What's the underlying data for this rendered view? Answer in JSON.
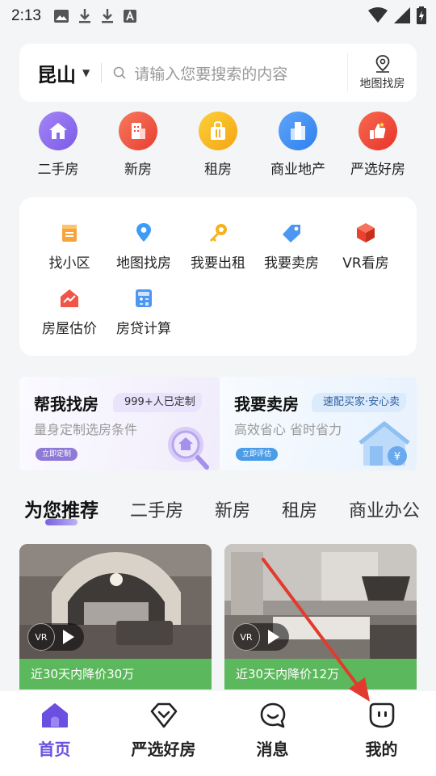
{
  "status_bar": {
    "time": "2:13"
  },
  "search": {
    "city": "昆山",
    "placeholder": "请输入您要搜索的内容",
    "map_label": "地图找房"
  },
  "categories": [
    {
      "label": "二手房",
      "icon": "home-icon",
      "color": "#8f6ff0"
    },
    {
      "label": "新房",
      "icon": "building-icon",
      "color": "#ef5542"
    },
    {
      "label": "租房",
      "icon": "bag-icon",
      "color": "#f8b51c"
    },
    {
      "label": "商业地产",
      "icon": "office-icon",
      "color": "#3b8ef3"
    },
    {
      "label": "严选好房",
      "icon": "thumbs-up-icon",
      "color": "#f0453a"
    }
  ],
  "tools": [
    {
      "label": "找小区",
      "icon": "community-icon"
    },
    {
      "label": "地图找房",
      "icon": "location-pin-icon"
    },
    {
      "label": "我要出租",
      "icon": "key-icon"
    },
    {
      "label": "我要卖房",
      "icon": "tag-icon"
    },
    {
      "label": "VR看房",
      "icon": "cube-icon"
    },
    {
      "label": "房屋估价",
      "icon": "trend-icon"
    },
    {
      "label": "房贷计算",
      "icon": "calculator-icon"
    }
  ],
  "promo": {
    "left": {
      "title": "帮我找房",
      "tag": "999+人已定制",
      "subtitle": "量身定制选房条件",
      "button": "立即定制"
    },
    "right": {
      "title": "我要卖房",
      "tag": "速配买家·安心卖",
      "subtitle": "高效省心 省时省力",
      "button": "立即评估"
    }
  },
  "recommend_tabs": [
    "为您推荐",
    "二手房",
    "新房",
    "租房",
    "商业办公"
  ],
  "listings": [
    {
      "vr": "VR",
      "price_drop": "近30天内降价30万"
    },
    {
      "vr": "VR",
      "price_drop": "近30天内降价12万"
    }
  ],
  "bottom_nav": [
    {
      "label": "首页",
      "icon": "home-icon",
      "active": true
    },
    {
      "label": "严选好房",
      "icon": "shield-check-icon",
      "active": false
    },
    {
      "label": "消息",
      "icon": "chat-icon",
      "active": false
    },
    {
      "label": "我的",
      "icon": "profile-icon",
      "active": false
    }
  ],
  "colors": {
    "accent": "#6b4fe0",
    "price_drop_bg": "#5cb85c",
    "annotation_arrow": "#e23b2e"
  }
}
